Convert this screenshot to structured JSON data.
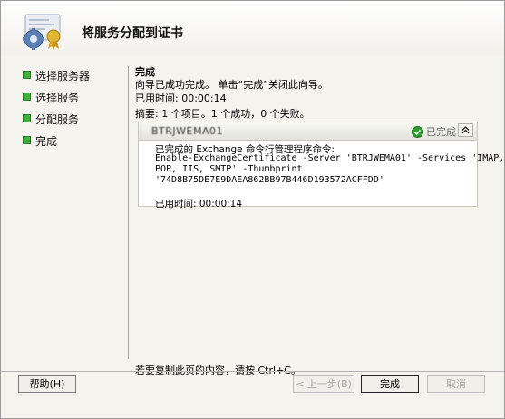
{
  "header": {
    "title": "将服务分配到证书"
  },
  "sidebar": {
    "items": [
      {
        "label": "选择服务器"
      },
      {
        "label": "选择服务"
      },
      {
        "label": "分配服务"
      },
      {
        "label": "完成"
      }
    ]
  },
  "content": {
    "section_title": "完成",
    "wizard_message": "向导已成功完成。 单击“完成”关闭此向导。",
    "elapsed": "已用时间: 00:00:14",
    "summary": "摘要: 1 个项目。1 个成功，0 个失败。"
  },
  "result_panel": {
    "server_name": "BTRJWEMA01",
    "status": "已完成",
    "command_intro": "已完成的 Exchange 命令行管理程序命令:",
    "command_lines": [
      "Enable-ExchangeCertificate -Server 'BTRJWEMA01' -Services 'IMAP,",
      "POP, IIS, SMTP' -Thumbprint",
      "'74D8B75DE7E9DAEA862BB97B446D193572ACFFDD'"
    ],
    "elapsed": "已用时间: 00:00:14"
  },
  "footer": {
    "copy_hint": "若要复制此页的内容，请按 Ctrl+C。",
    "help_label": "帮助(H)",
    "back_label": "< 上一步(B)",
    "finish_label": "完成",
    "cancel_label": "取消"
  },
  "colors": {
    "nav_bullet": "#3bb33b",
    "success_icon": "#2e9a2e",
    "background": "#f4f3ee"
  },
  "icons": {
    "wizard": "certificate-gear-icon",
    "status": "checkmark-circle-icon",
    "collapse": "double-chevron-up-icon",
    "nav": "green-square-bullet-icon"
  }
}
